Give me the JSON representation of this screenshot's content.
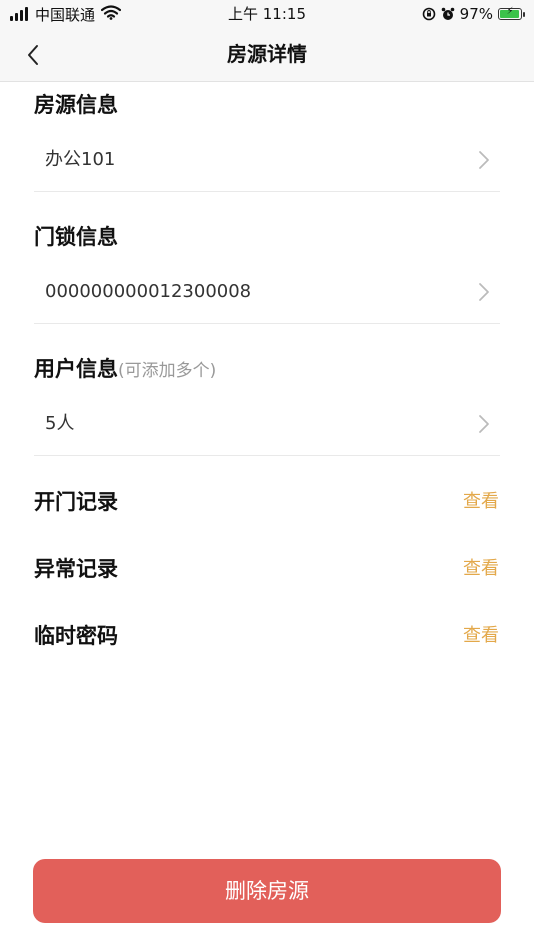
{
  "status_bar": {
    "carrier": "中国联通",
    "time": "上午 11:15",
    "battery_percent": "97%",
    "battery_level": 0.97,
    "icons": [
      "signal-icon",
      "wifi-icon",
      "orientation-lock-icon",
      "alarm-icon",
      "battery-icon"
    ]
  },
  "nav": {
    "title": "房源详情",
    "back_icon": "chevron-left-icon"
  },
  "sections": {
    "house": {
      "title": "房源信息",
      "value": "办公101"
    },
    "lock": {
      "title": "门锁信息",
      "value": "000000000012300008"
    },
    "users": {
      "title": "用户信息",
      "hint": "(可添加多个)",
      "value": "5人"
    }
  },
  "records": [
    {
      "label": "开门记录",
      "action": "查看"
    },
    {
      "label": "异常记录",
      "action": "查看"
    },
    {
      "label": "临时密码",
      "action": "查看"
    }
  ],
  "delete_button": {
    "label": "删除房源"
  },
  "colors": {
    "accent": "#e3a84a",
    "danger": "#e2605a",
    "battery": "#3bc24a"
  }
}
